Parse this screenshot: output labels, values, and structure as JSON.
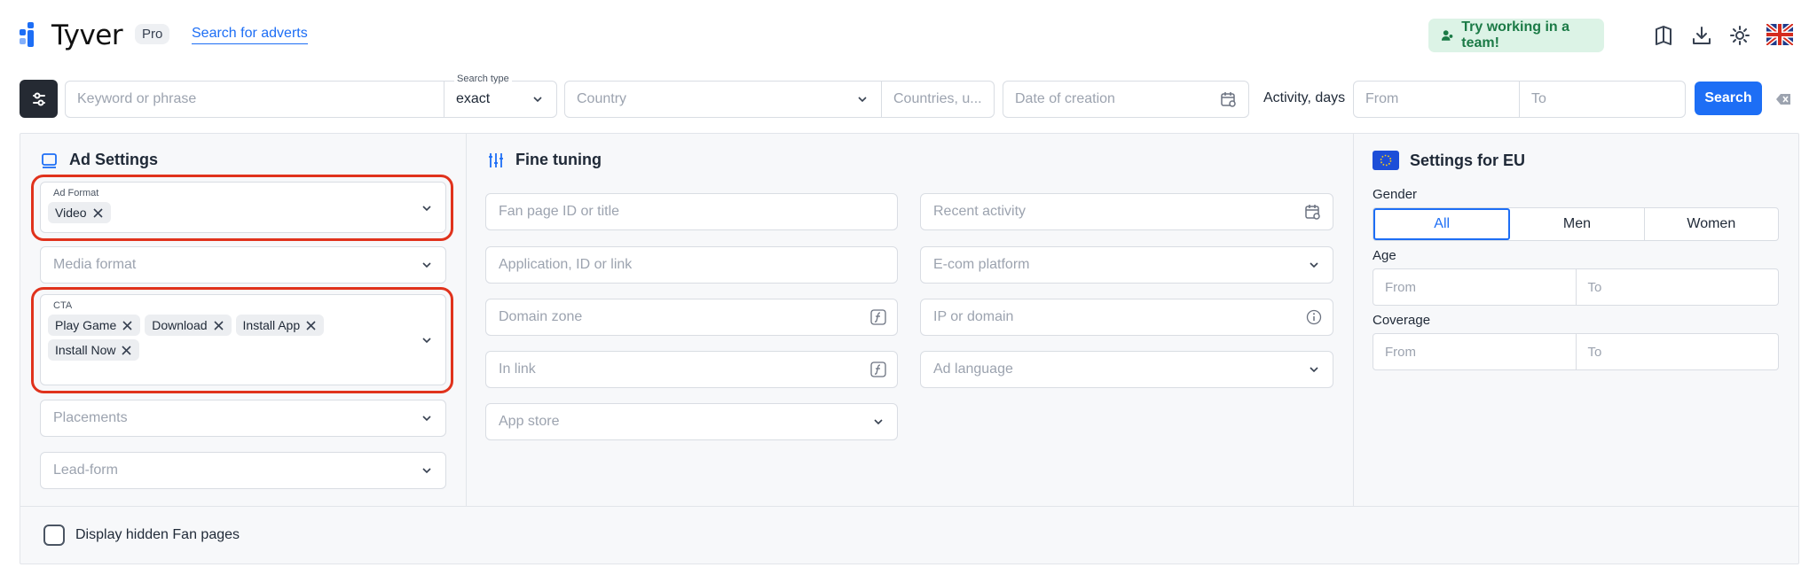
{
  "header": {
    "logo_text": "Tyver",
    "badge": "Pro",
    "nav_link": "Search for adverts",
    "team_button": "Try working in a team!",
    "icons": [
      "book-icon",
      "download-icon",
      "gear-icon",
      "uk-flag-icon"
    ]
  },
  "search_bar": {
    "keyword_placeholder": "Keyword or phrase",
    "search_type_label": "Search type",
    "search_type_value": "exact",
    "country_placeholder": "Country",
    "countries_placeholder": "Countries, u...",
    "date_placeholder": "Date of creation",
    "activity_label": "Activity, days",
    "from_placeholder": "From",
    "to_placeholder": "To",
    "search_button": "Search"
  },
  "ad_settings": {
    "title": "Ad Settings",
    "ad_format_label": "Ad Format",
    "ad_format_chips": [
      "Video"
    ],
    "media_format_placeholder": "Media format",
    "cta_label": "CTA",
    "cta_chips": [
      "Play Game",
      "Download",
      "Install App",
      "Install Now"
    ],
    "placements_placeholder": "Placements",
    "lead_form_placeholder": "Lead-form"
  },
  "fine_tuning": {
    "title": "Fine tuning",
    "fan_page_placeholder": "Fan page ID or title",
    "recent_activity_placeholder": "Recent activity",
    "application_placeholder": "Application, ID or link",
    "ecom_placeholder": "E-com platform",
    "domain_zone_placeholder": "Domain zone",
    "ip_domain_placeholder": "IP or domain",
    "in_link_placeholder": "In link",
    "ad_language_placeholder": "Ad language",
    "app_store_placeholder": "App store"
  },
  "eu_settings": {
    "title": "Settings for EU",
    "gender_label": "Gender",
    "gender_options": [
      "All",
      "Men",
      "Women"
    ],
    "gender_selected": "All",
    "age_label": "Age",
    "coverage_label": "Coverage",
    "from_placeholder": "From",
    "to_placeholder": "To"
  },
  "footer": {
    "hidden_fan_pages_label": "Display hidden Fan pages",
    "hidden_fan_pages_checked": false
  },
  "colors": {
    "accent": "#1d6ef5",
    "highlight": "#e0321c",
    "team_bg": "#dcf3e6",
    "team_text": "#1b7a46"
  }
}
